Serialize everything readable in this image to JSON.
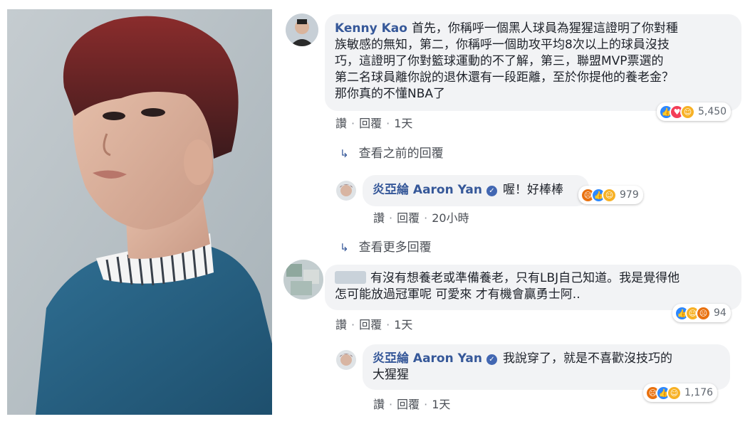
{
  "comments": [
    {
      "author": "Kenny Kao",
      "text_lines": [
        "首先，你稱呼一個黑人球員為猩猩這證明了你對種",
        "族敏感的無知，第二，你稱呼一個助攻平均8次以上的球員沒技",
        "巧，這證明了你對籃球運動的不了解，第三，聯盟MVP票選的",
        "第二名球員離你說的退休還有一段距離，至於你提他的養老金？",
        "那你真的不懂NBA了"
      ],
      "reaction_count": "5,450",
      "reaction_icons": [
        "like-icon",
        "love-icon",
        "haha-icon"
      ],
      "actions": [
        "讚",
        "回覆",
        "1天"
      ]
    },
    {
      "author": "炎亞綸 Aaron Yan",
      "text_lines": [
        "喔！好棒棒"
      ],
      "reaction_count": "979",
      "reaction_icons": [
        "angry-icon",
        "like-icon",
        "haha-icon"
      ],
      "actions": [
        "讚",
        "回覆",
        "20小時"
      ]
    },
    {
      "author": "",
      "text_lines": [
        "有沒有想養老或準備養老，只有LBJ自己知道。我是覺得他",
        "怎可能放過冠軍呢 可愛來 才有機會贏勇士阿.."
      ],
      "reaction_count": "94",
      "reaction_icons": [
        "like-icon",
        "haha-icon",
        "angry-icon"
      ],
      "actions": [
        "讚",
        "回覆",
        "1天"
      ]
    },
    {
      "author": "炎亞綸 Aaron Yan",
      "text_lines": [
        "我說穿了，就是不喜歡沒技巧的",
        "大猩猩"
      ],
      "reaction_count": "1,176",
      "reaction_icons": [
        "angry-icon",
        "like-icon",
        "haha-icon"
      ],
      "actions": [
        "讚",
        "回覆",
        "1天"
      ]
    }
  ],
  "view_previous": "查看之前的回覆",
  "view_more": "查看更多回覆",
  "colors": {
    "author": "#365899",
    "bubble": "#f2f3f5",
    "like": "#2d88ff",
    "love": "#f33e58",
    "haha": "#f7b125",
    "angry": "#e9710f"
  }
}
